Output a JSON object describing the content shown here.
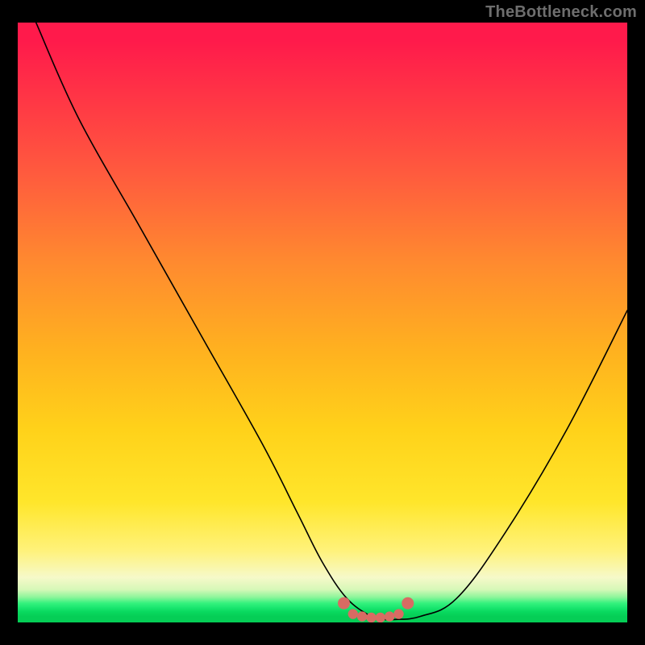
{
  "watermark": "TheBottleneck.com",
  "chart_data": {
    "type": "line",
    "title": "",
    "xlabel": "",
    "ylabel": "",
    "xlim": [
      0,
      100
    ],
    "ylim": [
      0,
      100
    ],
    "grid": false,
    "series": [
      {
        "name": "bottleneck-curve",
        "x": [
          3,
          10,
          20,
          30,
          40,
          46,
          50,
          54,
          58,
          60,
          62,
          66,
          72,
          80,
          90,
          100
        ],
        "values": [
          100,
          84,
          66,
          48,
          30,
          18,
          10,
          4,
          1,
          0.5,
          0.5,
          1,
          4,
          15,
          32,
          52
        ]
      }
    ],
    "markers": {
      "name": "bottom-cluster",
      "color": "#d86b63",
      "points_x": [
        53.5,
        55,
        56.5,
        58,
        59.5,
        61,
        62.5,
        64
      ],
      "points_y": [
        3.2,
        1.4,
        1.0,
        0.8,
        0.8,
        1.0,
        1.4,
        3.2
      ]
    },
    "gradient_stops": [
      {
        "pos": 0,
        "color": "#ff1a4b"
      },
      {
        "pos": 50,
        "color": "#ffa327"
      },
      {
        "pos": 85,
        "color": "#fff04a"
      },
      {
        "pos": 97,
        "color": "#34f27d"
      },
      {
        "pos": 100,
        "color": "#05ce56"
      }
    ]
  }
}
